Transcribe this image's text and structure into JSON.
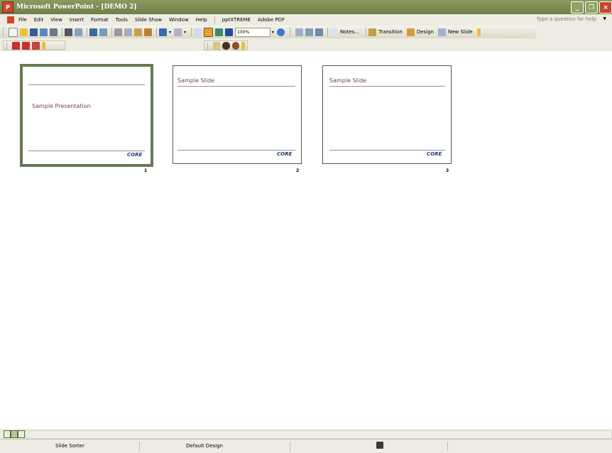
{
  "window": {
    "title": "Microsoft PowerPoint - [DEMO 2]"
  },
  "menu": {
    "items": [
      "File",
      "Edit",
      "View",
      "Insert",
      "Format",
      "Tools",
      "Slide Show",
      "Window",
      "Help",
      "pptXTREME",
      "Adobe PDF"
    ],
    "help_placeholder": "Type a question for help"
  },
  "toolbar": {
    "zoom": "100%",
    "notes_label": "Notes...",
    "transition_label": "Transition",
    "design_label": "Design",
    "new_slide_label": "New Slide"
  },
  "slides": [
    {
      "number": "1",
      "title": "",
      "subtitle": "Sample Presentation",
      "logo": "CORE",
      "selected": true
    },
    {
      "number": "2",
      "title": "Sample Slide",
      "subtitle": "",
      "logo": "CORE",
      "selected": false
    },
    {
      "number": "3",
      "title": "Sample Slide",
      "subtitle": "",
      "logo": "CORE",
      "selected": false
    }
  ],
  "status": {
    "view": "Slide Sorter",
    "design": "Default Design"
  },
  "colors": {
    "titlebar": "#6f7f48",
    "slide_text": "#7a3a5a",
    "selection": "#667a52"
  }
}
